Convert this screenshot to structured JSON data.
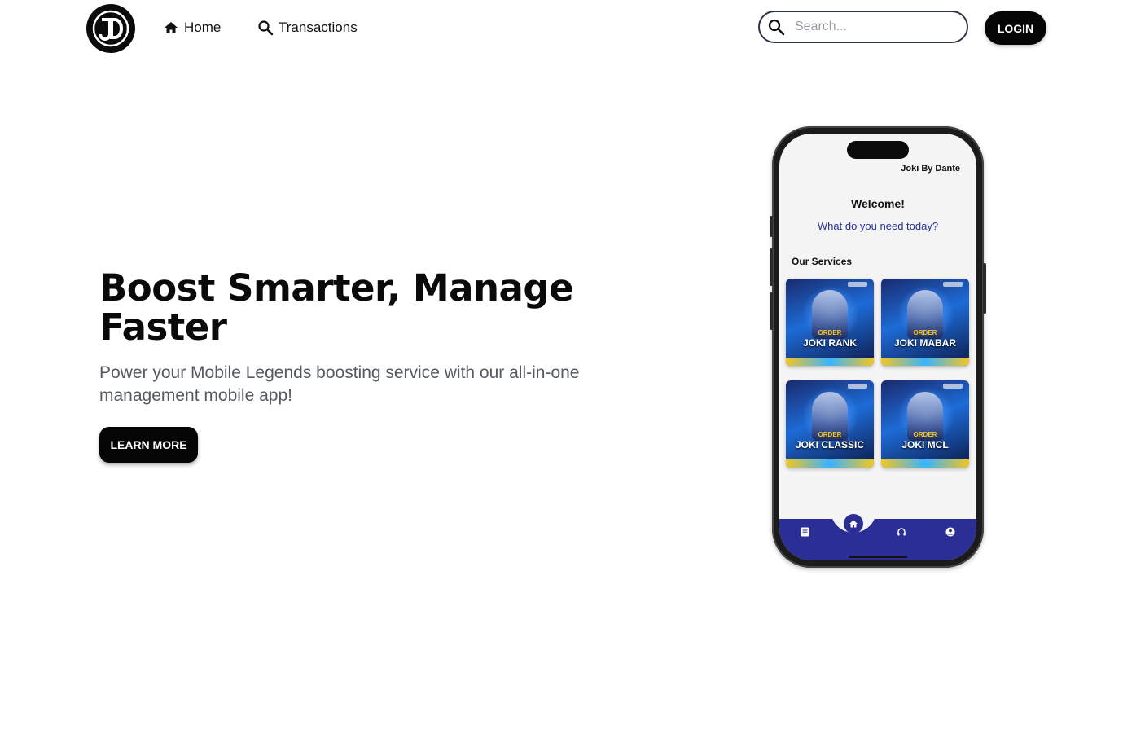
{
  "nav": {
    "logo_text": "JD",
    "links": [
      {
        "label": "Home",
        "icon": "home-icon"
      },
      {
        "label": "Transactions",
        "icon": "search-icon"
      }
    ],
    "search_placeholder": "Search...",
    "login_label": "LOGIN"
  },
  "hero": {
    "title": "Boost Smarter, Manage Faster",
    "subtitle": "Power your Mobile Legends boosting service with our all-in-one management mobile app!",
    "cta_label": "LEARN MORE"
  },
  "phone": {
    "app_title": "Joki By Dante",
    "welcome": "Welcome!",
    "question": "What do you need today?",
    "services_label": "Our Services",
    "services": [
      {
        "order": "ORDER",
        "name": "JOKI RANK"
      },
      {
        "order": "ORDER",
        "name": "JOKI MABAR"
      },
      {
        "order": "ORDER",
        "name": "JOKI CLASSIC"
      },
      {
        "order": "ORDER",
        "name": "JOKI MCL"
      }
    ],
    "bottom_nav": [
      "document-icon",
      "home-icon",
      "headset-icon",
      "profile-icon"
    ]
  },
  "colors": {
    "primary_dark": "#050505",
    "app_accent": "#2a2e95",
    "subtitle_text": "#555a60"
  }
}
